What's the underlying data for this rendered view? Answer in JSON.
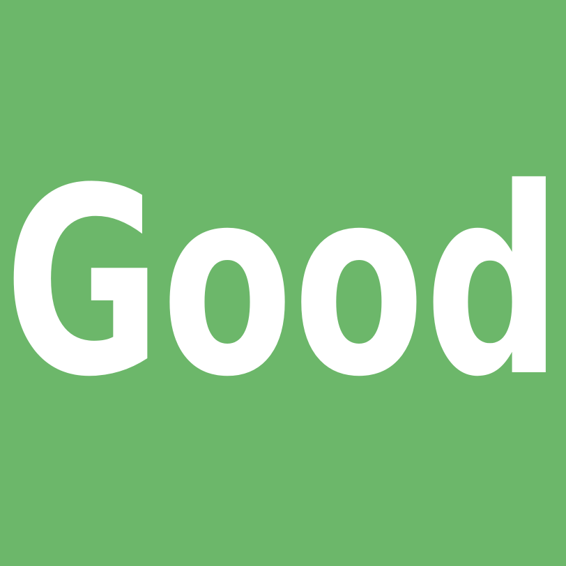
{
  "word": "Good",
  "colors": {
    "background": "#6cb76a",
    "text": "#ffffff"
  }
}
